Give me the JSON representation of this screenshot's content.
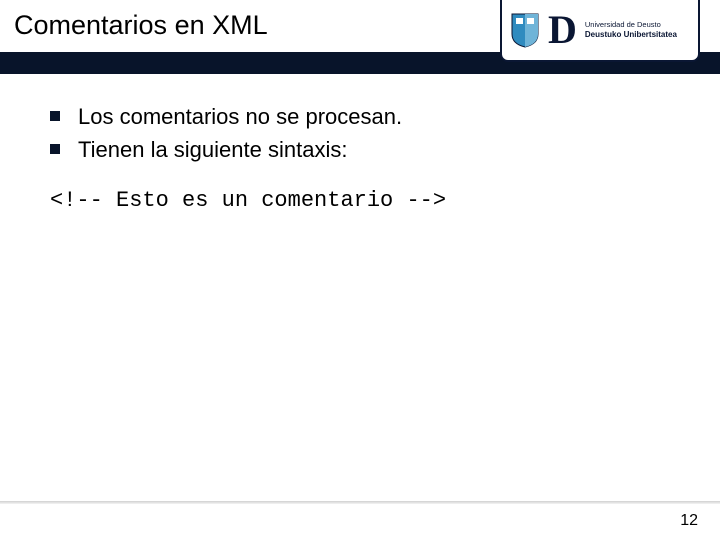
{
  "header": {
    "title": "Comentarios en XML",
    "logo": {
      "line1": "Universidad de Deusto",
      "line2": "Deustuko Unibertsitatea",
      "letter": "D"
    }
  },
  "content": {
    "bullets": [
      "Los comentarios no se procesan.",
      "Tienen la siguiente sintaxis:"
    ],
    "code": "<!-- Esto es un comentario -->"
  },
  "footer": {
    "page_number": "12"
  }
}
